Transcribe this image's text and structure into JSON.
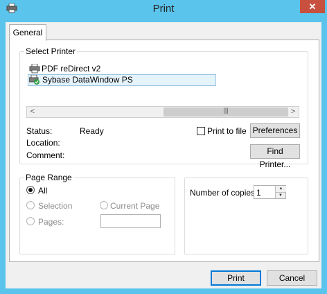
{
  "window": {
    "title": "Print",
    "app_icon": "printer-icon",
    "close_symbol": "✕"
  },
  "tabs": [
    {
      "label": "General",
      "selected": true
    }
  ],
  "select_printer": {
    "legend": "Select Printer",
    "printers": [
      {
        "name": "PDF reDirect v2",
        "icon": "printer-icon",
        "selected": false
      },
      {
        "name": "Sybase DataWindow PS",
        "icon": "default-printer-icon",
        "selected": true
      }
    ],
    "scroll_left": "<",
    "scroll_right": ">",
    "scroll_grip": "|||",
    "status_label": "Status:",
    "status_value": "Ready",
    "location_label": "Location:",
    "location_value": "",
    "comment_label": "Comment:",
    "comment_value": "",
    "print_to_file_label": "Print to file",
    "print_to_file_checked": false,
    "preferences_button": "Preferences",
    "find_printer_button": "Find Printer..."
  },
  "page_range": {
    "legend": "Page Range",
    "all_label": "All",
    "selection_label": "Selection",
    "current_page_label": "Current Page",
    "pages_label": "Pages:",
    "pages_value": "",
    "selected": "All"
  },
  "copies": {
    "label": "Number of copies:",
    "value": "1",
    "up_arrow": "▲",
    "down_arrow": "▼"
  },
  "footer": {
    "print_button": "Print",
    "cancel_button": "Cancel"
  },
  "colors": {
    "titlebar": "#5bc4ec",
    "close_button": "#c7503f",
    "selection_highlight": "#e5f3fb",
    "default_button_border": "#0078d7"
  }
}
